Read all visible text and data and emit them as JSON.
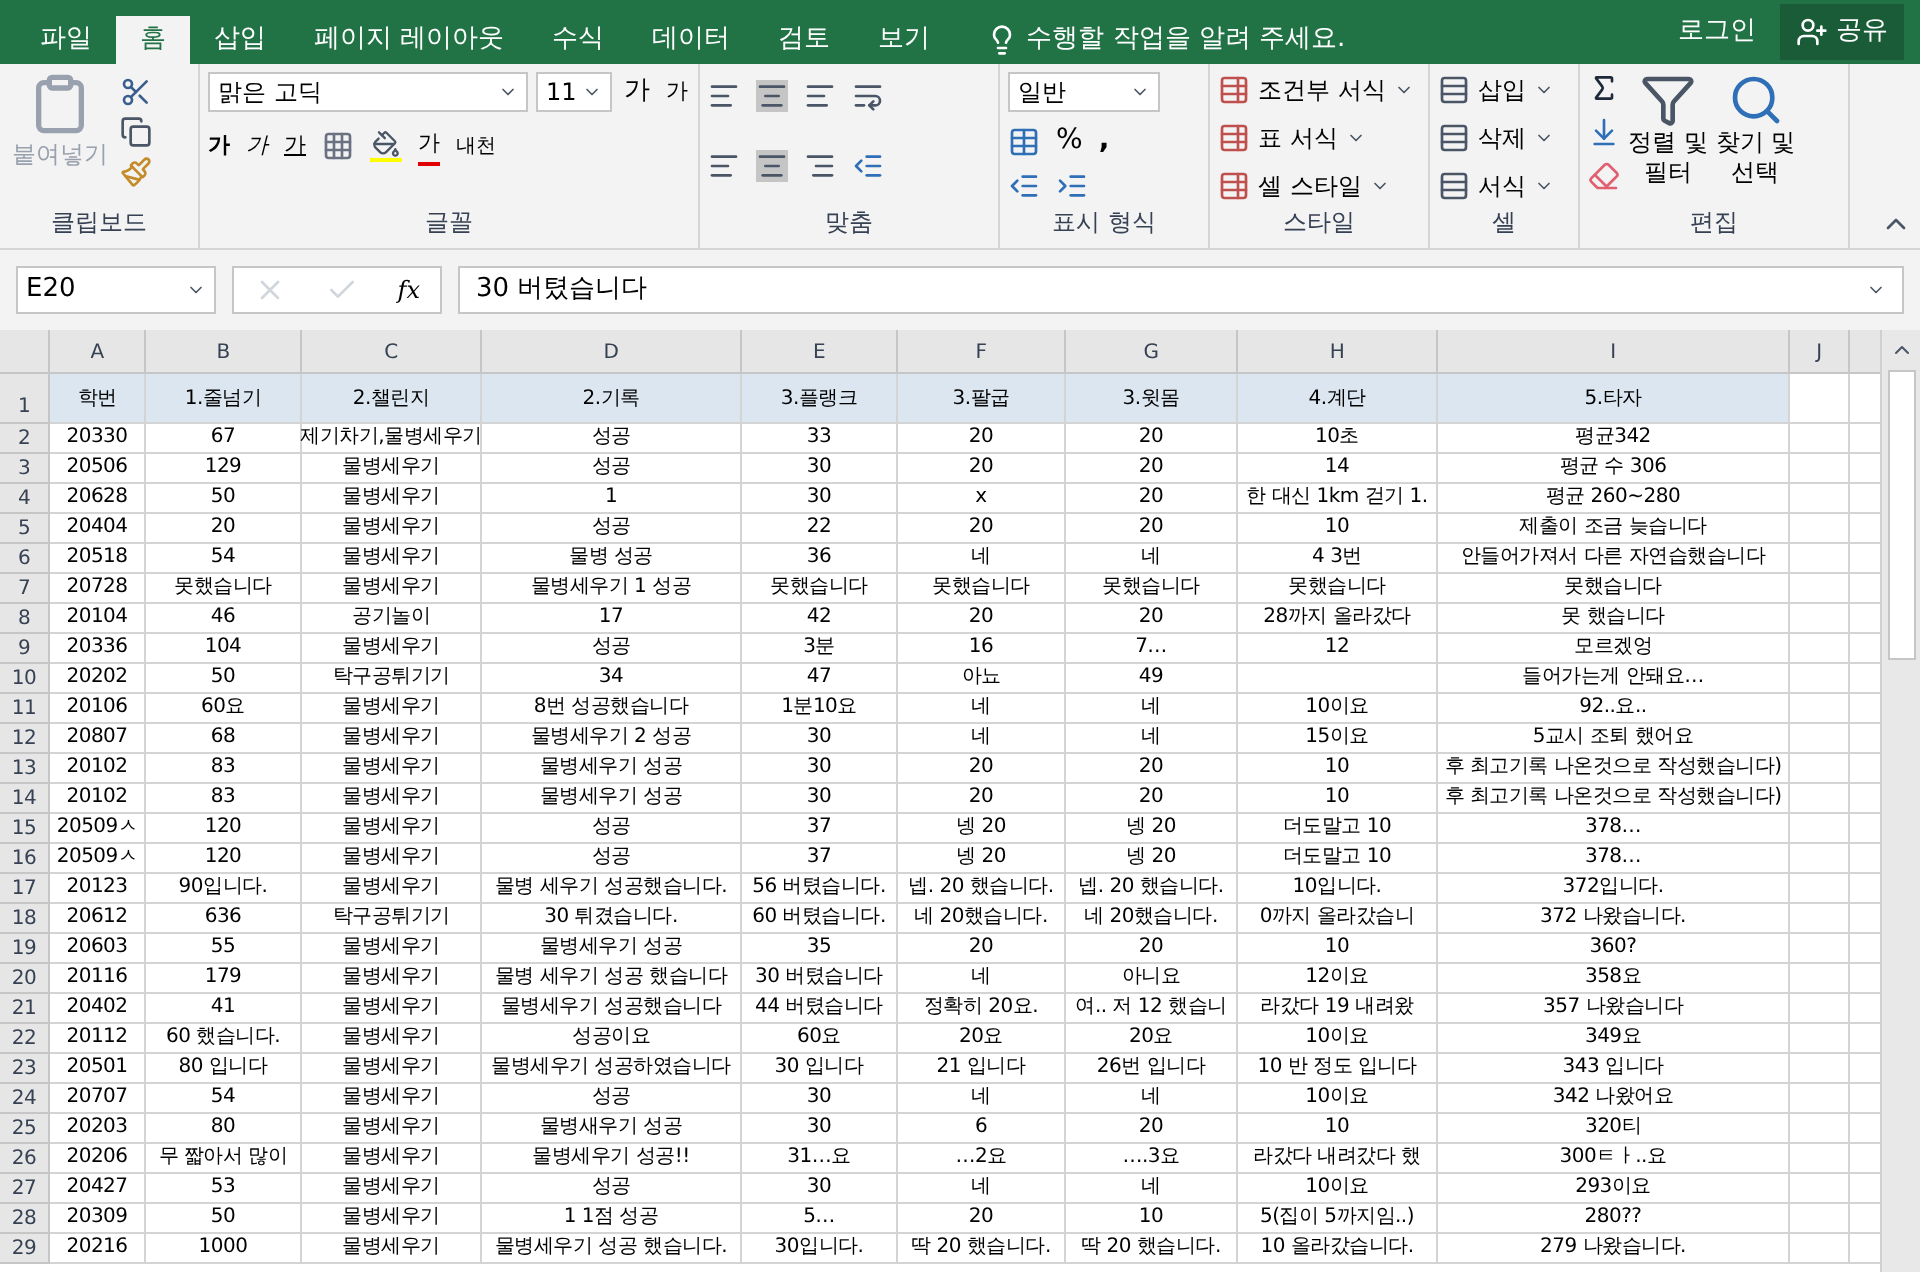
{
  "tabs": [
    {
      "label": "파일",
      "selected": false
    },
    {
      "label": "홈",
      "selected": true
    },
    {
      "label": "삽입",
      "selected": false
    },
    {
      "label": "페이지 레이아웃",
      "selected": false
    },
    {
      "label": "수식",
      "selected": false
    },
    {
      "label": "데이터",
      "selected": false
    },
    {
      "label": "검토",
      "selected": false
    },
    {
      "label": "보기",
      "selected": false
    }
  ],
  "tell_me": {
    "placeholder": "수행할 작업을 알려 주세요."
  },
  "sign_in": "로그인",
  "share": "공유",
  "clipboard": {
    "paste": "붙여넣기",
    "label": "클립보드"
  },
  "font": {
    "name": "맑은 고딕",
    "size": "11",
    "grow": "가",
    "shrink": "가",
    "bold": "가",
    "italic": "가",
    "underline": "가",
    "font_color": "가",
    "phonetic": "내천",
    "label": "글꼴"
  },
  "alignment": {
    "label": "맞춤"
  },
  "number": {
    "format": "일반",
    "percent": "%",
    "comma": ",",
    "label": "표시 형식"
  },
  "styles": {
    "items": [
      "조건부 서식",
      "표 서식",
      "셀 스타일"
    ],
    "label": "스타일"
  },
  "cells": {
    "items": [
      "삽입",
      "삭제",
      "서식"
    ],
    "label": "셀"
  },
  "editing": {
    "sort_filter": [
      "정렬 및",
      "필터"
    ],
    "find_select": [
      "찾기 및",
      "선택"
    ],
    "label": "편집"
  },
  "formula_bar": {
    "name_box": "E20",
    "fx": "fx",
    "value": "30 버텼습니다"
  },
  "sheet": {
    "columns": [
      "A",
      "B",
      "C",
      "D",
      "E",
      "F",
      "G",
      "H",
      "I",
      "J"
    ],
    "header_row": {
      "number": "1",
      "cells": [
        "학번",
        "1.줄넘기",
        "2.챌린지",
        "2.기록",
        "3.플랭크",
        "3.팔굽",
        "3.윗몸",
        "4.계단",
        "5.타자"
      ]
    },
    "rows": [
      {
        "number": "2",
        "cells": [
          "20330",
          "67",
          "제기차기,물병세우기",
          "성공",
          "33",
          "20",
          "20",
          "10초",
          "평균342"
        ]
      },
      {
        "number": "3",
        "cells": [
          "20506",
          "129",
          "물병세우기",
          "성공",
          "30",
          "20",
          "20",
          "14",
          "평균 수 306"
        ]
      },
      {
        "number": "4",
        "cells": [
          "20628",
          "50",
          "물병세우기",
          "1",
          "30",
          "x",
          "20",
          "한 대신 1km 걷기 1.",
          "평균 260~280"
        ]
      },
      {
        "number": "5",
        "cells": [
          "20404",
          "20",
          "물병세우기",
          "성공",
          "22",
          "20",
          "20",
          "10",
          "제출이 조금 늦습니다"
        ]
      },
      {
        "number": "6",
        "cells": [
          "20518",
          "54",
          "물병세우기",
          "물병 성공",
          "36",
          "네",
          "네",
          "4 3번",
          "안들어가져서 다른 자연습했습니다"
        ]
      },
      {
        "number": "7",
        "cells": [
          "20728",
          "못했습니다",
          "물병세우기",
          "물병세우기 1 성공",
          "못했습니다",
          "못했습니다",
          "못했습니다",
          "못했습니다",
          "못했습니다"
        ]
      },
      {
        "number": "8",
        "cells": [
          "20104",
          "46",
          "공기놀이",
          "17",
          "42",
          "20",
          "20",
          "28까지 올라갔다",
          "못 했습니다"
        ]
      },
      {
        "number": "9",
        "cells": [
          "20336",
          "104",
          "물병세우기",
          "성공",
          "3분",
          "16",
          "7…",
          "12",
          "모르겠엉"
        ]
      },
      {
        "number": "10",
        "cells": [
          "20202",
          "50",
          "탁구공튀기기",
          "34",
          "47",
          "아뇨",
          "49",
          null,
          "들어가는게 안돼요…"
        ]
      },
      {
        "number": "11",
        "cells": [
          "20106",
          "60요",
          "물병세우기",
          "8번 성공했습니다",
          "1분10요",
          "네",
          "네",
          "10이요",
          "92..요.."
        ]
      },
      {
        "number": "12",
        "cells": [
          "20807",
          "68",
          "물병세우기",
          "물병세우기 2 성공",
          "30",
          "네",
          "네",
          "15이요",
          "5교시 조퇴 했어요"
        ]
      },
      {
        "number": "13",
        "cells": [
          "20102",
          "83",
          "물병세우기",
          "물병세우기 성공",
          "30",
          "20",
          "20",
          "10",
          "후 최고기록 나온것으로 작성했습니다)"
        ]
      },
      {
        "number": "14",
        "cells": [
          "20102",
          "83",
          "물병세우기",
          "물병세우기 성공",
          "30",
          "20",
          "20",
          "10",
          "후 최고기록 나온것으로 작성했습니다)"
        ]
      },
      {
        "number": "15",
        "cells": [
          "20509ㅅ",
          "120",
          "물병세우기",
          "성공",
          "37",
          "넹 20",
          "넹 20",
          "더도말고 10",
          "378…"
        ]
      },
      {
        "number": "16",
        "cells": [
          "20509ㅅ",
          "120",
          "물병세우기",
          "성공",
          "37",
          "넹 20",
          "넹 20",
          "더도말고 10",
          "378…"
        ]
      },
      {
        "number": "17",
        "cells": [
          "20123",
          "90입니다.",
          "물병세우기",
          "물병 세우기 성공했습니다.",
          "56 버텼습니다.",
          "넵. 20 했습니다.",
          "넵. 20 했습니다.",
          "10입니다.",
          "372입니다."
        ]
      },
      {
        "number": "18",
        "cells": [
          "20612",
          "636",
          "탁구공튀기기",
          "30 튀겼습니다.",
          "60 버텼습니다.",
          "네 20했습니다.",
          "네 20했습니다.",
          "0까지 올라갔습니",
          "372 나왔습니다."
        ]
      },
      {
        "number": "19",
        "cells": [
          "20603",
          "55",
          "물병세우기",
          "물병세우기 성공",
          "35",
          "20",
          "20",
          "10",
          "360?"
        ]
      },
      {
        "number": "20",
        "cells": [
          "20116",
          "179",
          "물병세우기",
          "물병 세우기 성공 했습니다",
          "30 버텼습니다",
          "네",
          "아니요",
          "12이요",
          "358요"
        ]
      },
      {
        "number": "21",
        "cells": [
          "20402",
          "41",
          "물병세우기",
          "물병세우기 성공했습니다",
          "44 버텼습니다",
          "정확히 20요.",
          "여.. 저 12 했습니",
          "라갔다 19 내려왔",
          "357 나왔습니다"
        ]
      },
      {
        "number": "22",
        "cells": [
          "20112",
          "60 했습니다.",
          "물병세우기",
          "성공이요",
          "60요",
          "20요",
          "20요",
          "10이요",
          "349요"
        ]
      },
      {
        "number": "23",
        "cells": [
          "20501",
          "80 입니다",
          "물병세우기",
          "물병세우기 성공하였습니다",
          "30 입니다",
          "21 입니다",
          "26번 입니다",
          "10 반 정도 입니다",
          "343 입니다"
        ]
      },
      {
        "number": "24",
        "cells": [
          "20707",
          "54",
          "물병세우기",
          "성공",
          "30",
          "네",
          "네",
          "10이요",
          "342 나왔어요"
        ]
      },
      {
        "number": "25",
        "cells": [
          "20203",
          "80",
          "물병세우기",
          "물병새우기 성공",
          "30",
          "6",
          "20",
          "10",
          "320티"
        ]
      },
      {
        "number": "26",
        "cells": [
          "20206",
          "무 짧아서 많이",
          "물병세우기",
          "물병세우기 성공!!",
          "31…요",
          "…2요",
          "….3요",
          "라갔다 내려갔다 했",
          "300ㅌㅏ..요"
        ]
      },
      {
        "number": "27",
        "cells": [
          "20427",
          "53",
          "물병세우기",
          "성공",
          "30",
          "네",
          "네",
          "10이요",
          "293이요"
        ]
      },
      {
        "number": "28",
        "cells": [
          "20309",
          "50",
          "물병세우기",
          "1 1점 성공",
          "5…",
          "20",
          "10",
          "5(집이 5까지임..)",
          "280??"
        ]
      },
      {
        "number": "29",
        "cells": [
          "20216",
          "1000",
          "물병세우기",
          "물병세우기 성공 했습니다.",
          "30입니다.",
          "딱 20 했습니다.",
          "딱 20 했습니다.",
          "10 올라갔습니다.",
          "279 나왔습니다."
        ]
      }
    ]
  }
}
